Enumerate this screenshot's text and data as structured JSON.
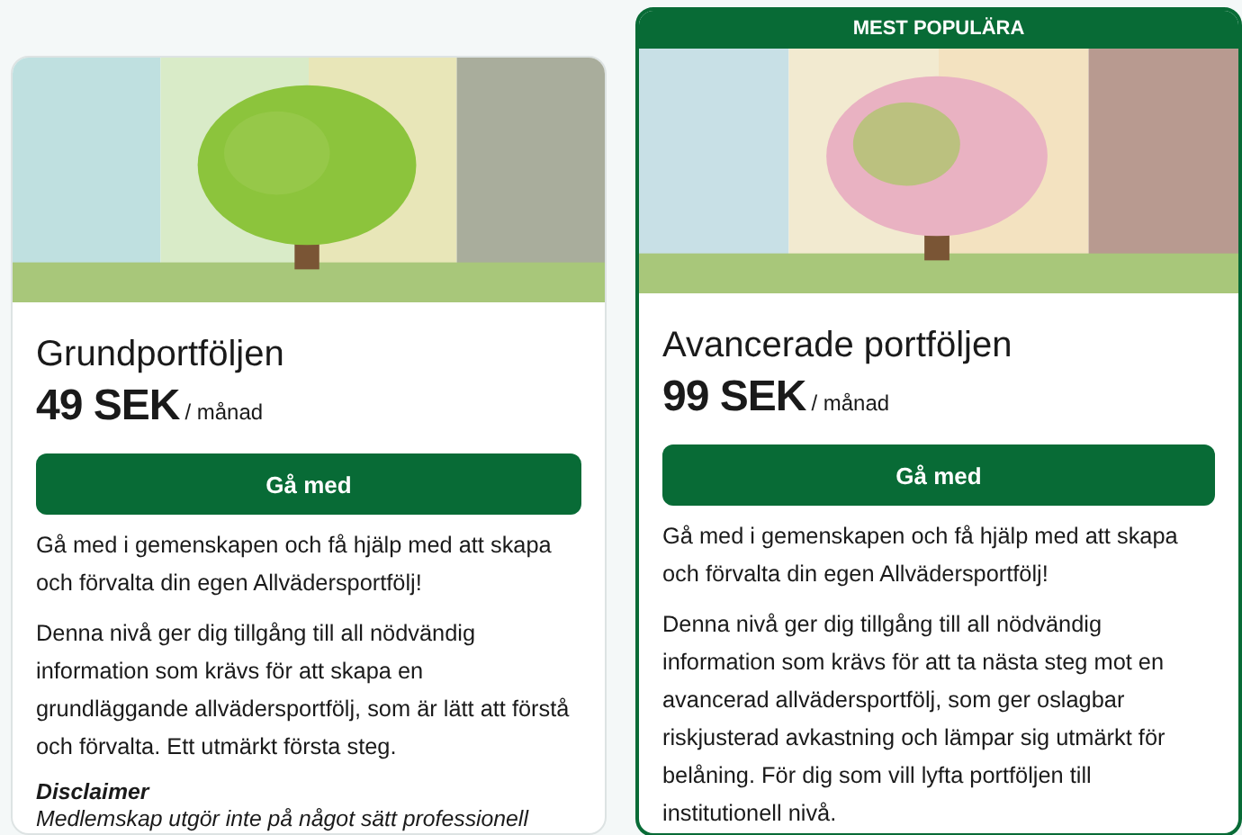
{
  "plans": [
    {
      "title": "Grundportföljen",
      "price": "49 SEK",
      "period": "/ månad",
      "button": "Gå med",
      "paragraphs": [
        "Gå med i gemenskapen och få hjälp med att skapa och förvalta din egen Allvädersportfölj!",
        "Denna nivå ger dig tillgång till all nödvändig information som krävs för att skapa en grundläggande allvädersportfölj, som är lätt att förstå och förvalta. Ett utmärkt första steg."
      ],
      "disclaimer": {
        "heading": "Disclaimer",
        "text": "Medlemskap utgör inte på något sätt professionell"
      }
    },
    {
      "badge": "MEST POPULÄRA",
      "title": "Avancerade portföljen",
      "price": "99 SEK",
      "period": "/ månad",
      "button": "Gå med",
      "paragraphs": [
        "Gå med i gemenskapen och få hjälp med att skapa och förvalta din egen Allvädersportfölj!",
        "Denna nivå ger dig tillgång till all nödvändig information som krävs för att ta nästa steg mot en avancerad allvädersportfölj, som ger oslagbar riskjusterad avkastning och lämpar sig utmärkt för belåning. För dig som vill lyfta portföljen till institutionell nivå."
      ]
    }
  ]
}
